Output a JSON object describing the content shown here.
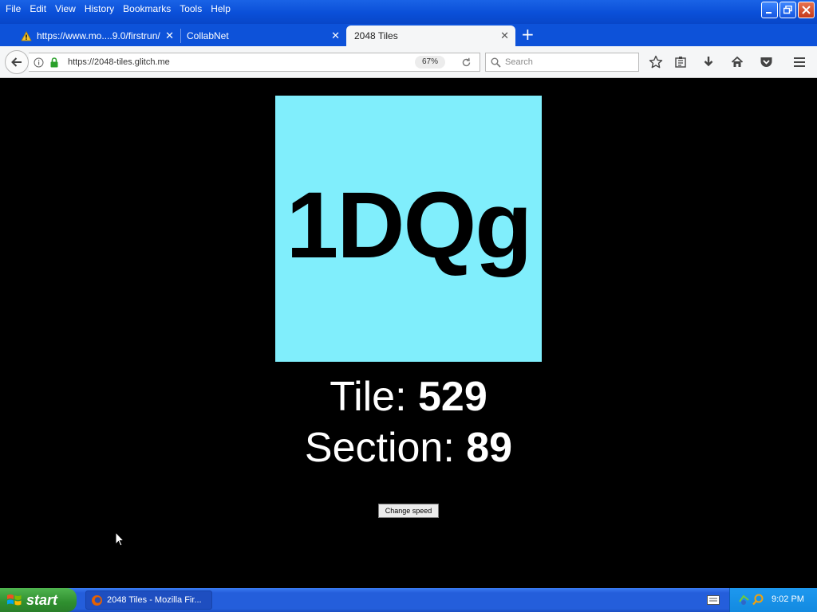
{
  "menu": [
    "File",
    "Edit",
    "View",
    "History",
    "Bookmarks",
    "Tools",
    "Help"
  ],
  "tabs": [
    {
      "title": "https://www.mo....9.0/firstrun/",
      "warning": true
    },
    {
      "title": "CollabNet",
      "warning": false
    },
    {
      "title": "2048 Tiles",
      "warning": false,
      "active": true
    }
  ],
  "address": {
    "url": "https://2048-tiles.glitch.me",
    "zoom": "67%"
  },
  "search": {
    "placeholder": "Search"
  },
  "page": {
    "tile_text": "1DQg",
    "tile_color": "#80eefc",
    "tile_label": "Tile:",
    "tile_value": "529",
    "section_label": "Section:",
    "section_value": "89",
    "button_label": "Change speed"
  },
  "taskbar": {
    "start_label": "start",
    "task_title": "2048 Tiles - Mozilla Fir...",
    "clock": "9:02 PM"
  }
}
